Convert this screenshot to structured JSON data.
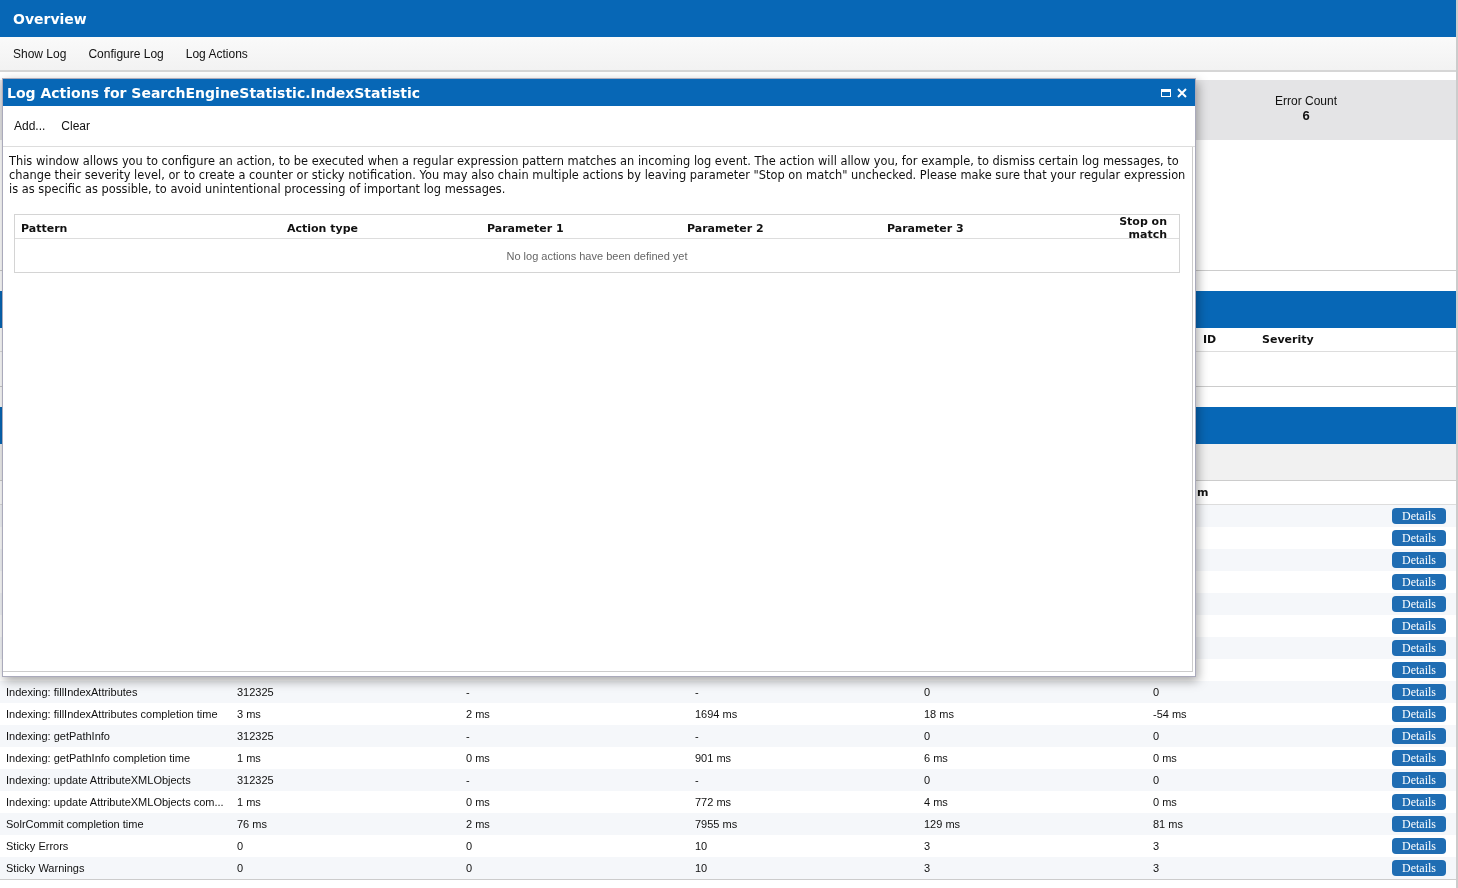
{
  "header": {
    "title": "Overview"
  },
  "menu": [
    "Show Log",
    "Configure Log",
    "Log Actions"
  ],
  "summary": {
    "label": "Error Count",
    "value": "6"
  },
  "events_table": {
    "columns": [
      "ID",
      "Severity"
    ]
  },
  "stats_table": {
    "columns": [
      "m"
    ],
    "rows": [
      {
        "button": "Details"
      },
      {
        "button": "Details"
      },
      {
        "button": "Details"
      },
      {
        "button": "Details"
      },
      {
        "button": "Details"
      },
      {
        "button": "Details"
      },
      {
        "button": "Details"
      },
      {
        "button": "Details"
      },
      {
        "cells": [
          "Indexing: fillIndexAttributes",
          "312325",
          "-",
          "-",
          "0",
          "0"
        ],
        "button": "Details"
      },
      {
        "cells": [
          "Indexing: fillIndexAttributes completion time",
          "3 ms",
          "2 ms",
          "1694 ms",
          "18 ms",
          "-54 ms"
        ],
        "button": "Details"
      },
      {
        "cells": [
          "Indexing: getPathInfo",
          "312325",
          "-",
          "-",
          "0",
          "0"
        ],
        "button": "Details"
      },
      {
        "cells": [
          "Indexing: getPathInfo completion time",
          "1 ms",
          "0 ms",
          "901 ms",
          "6 ms",
          "0 ms"
        ],
        "button": "Details"
      },
      {
        "cells": [
          "Indexing: update AttributeXMLObjects",
          "312325",
          "-",
          "-",
          "0",
          "0"
        ],
        "button": "Details"
      },
      {
        "cells": [
          "Indexing: update AttributeXMLObjects com...",
          "1 ms",
          "0 ms",
          "772 ms",
          "4 ms",
          "0 ms"
        ],
        "button": "Details"
      },
      {
        "cells": [
          "SolrCommit completion time",
          "76 ms",
          "2 ms",
          "7955 ms",
          "129 ms",
          "81 ms"
        ],
        "button": "Details"
      },
      {
        "cells": [
          "Sticky Errors",
          "0",
          "0",
          "10",
          "3",
          "3"
        ],
        "button": "Details"
      },
      {
        "cells": [
          "Sticky Warnings",
          "0",
          "0",
          "10",
          "3",
          "3"
        ],
        "button": "Details"
      }
    ]
  },
  "dialog": {
    "title": "Log Actions for SearchEngineStatistic.IndexStatistic",
    "toolbar": [
      "Add...",
      "Clear"
    ],
    "description": "This window allows you to configure an action, to be executed when a regular expression pattern matches an incoming log event. The action will allow you, for example, to dismiss certain log messages, to change their severity level, or to create a counter or sticky notification. You may also chain multiple actions by leaving parameter \"Stop on match\" unchecked. Please make sure that your regular expression is as specific as possible, to avoid unintentional processing of important log messages.",
    "table": {
      "columns": [
        "Pattern",
        "Action type",
        "Parameter 1",
        "Parameter 2",
        "Parameter 3",
        "Stop on match"
      ],
      "empty_text": "No log actions have been defined yet"
    }
  }
}
